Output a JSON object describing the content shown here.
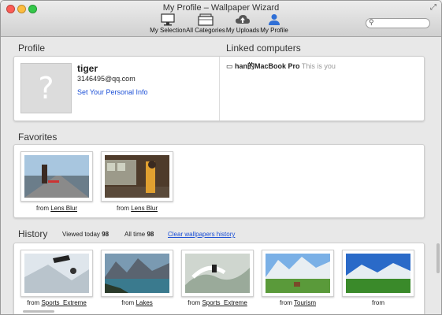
{
  "window": {
    "title": "My Profile – Wallpaper Wizard"
  },
  "toolbar": {
    "items": [
      {
        "label": "My Selection",
        "icon": "monitor-icon"
      },
      {
        "label": "All Categories",
        "icon": "folders-icon"
      },
      {
        "label": "My Uploads",
        "icon": "cloud-upload-icon"
      },
      {
        "label": "My Profile",
        "icon": "person-icon",
        "active": true
      }
    ]
  },
  "search": {
    "placeholder": ""
  },
  "profile": {
    "heading": "Profile",
    "avatar_glyph": "?",
    "username": "tiger",
    "email": "3146495@qq.com",
    "set_info_link": "Set Your Personal Info"
  },
  "linked": {
    "heading": "Linked computers",
    "computer_name": "han的MacBook Pro",
    "this_is_you": "This is you"
  },
  "favorites": {
    "heading": "Favorites",
    "items": [
      {
        "from_prefix": "from",
        "source": "Lens Blur"
      },
      {
        "from_prefix": "from",
        "source": "Lens Blur"
      }
    ]
  },
  "history": {
    "heading": "History",
    "viewed_today_label": "Viewed today",
    "viewed_today_count": "98",
    "all_time_label": "All time",
    "all_time_count": "98",
    "clear_link": "Clear wallpapers history",
    "items": [
      {
        "from_prefix": "from",
        "source": "Sports_Extreme"
      },
      {
        "from_prefix": "from",
        "source": "Lakes"
      },
      {
        "from_prefix": "from",
        "source": "Sports_Extreme"
      },
      {
        "from_prefix": "from",
        "source": "Tourism"
      },
      {
        "from_prefix": "from",
        "source": ""
      }
    ]
  },
  "colors": {
    "link": "#1b4fd6",
    "active_tab": "#2f6fd6"
  }
}
